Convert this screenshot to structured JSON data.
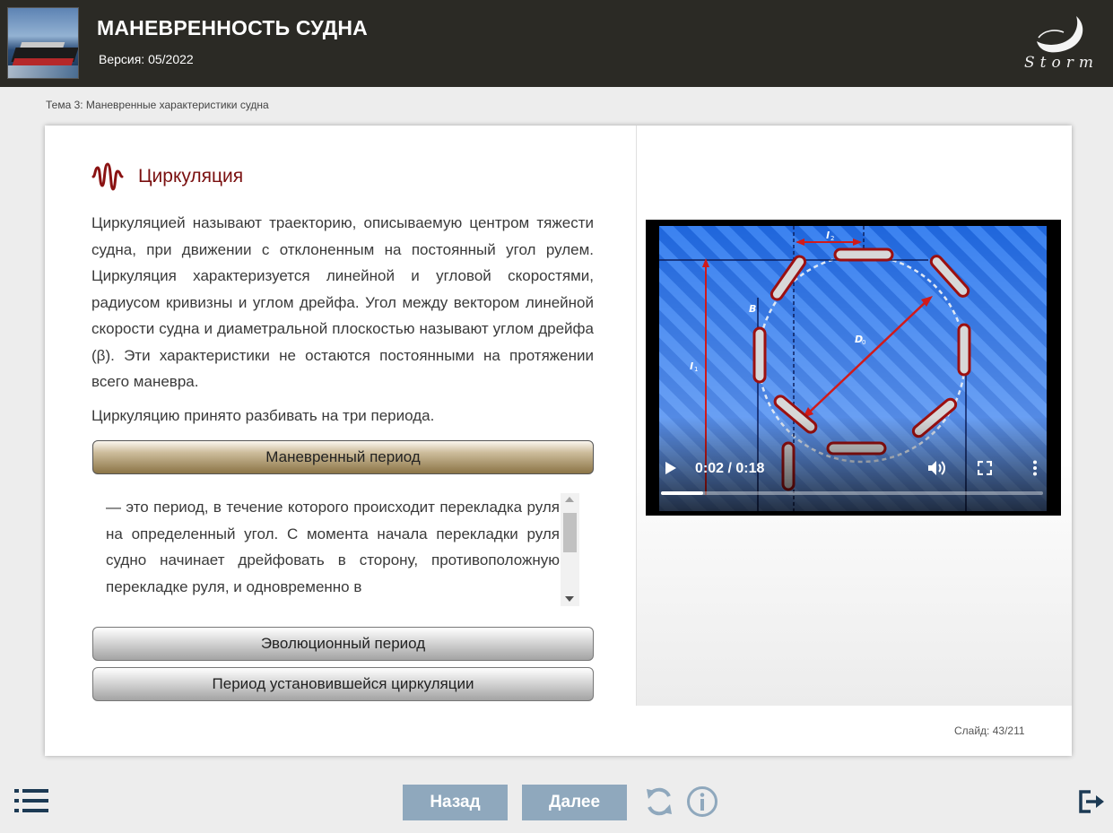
{
  "header": {
    "title": "МАНЕВРЕННОСТЬ СУДНА",
    "version": "Версия: 05/2022",
    "logo_text": "Storm"
  },
  "breadcrumb": "Тема 3: Маневренные характеристики судна",
  "section": {
    "title": "Циркуляция",
    "paragraph": "Циркуляцией называют траекторию, описываемую центром тяжести судна, при движении с отклоненным на постоянный угол рулем. Циркуляция характеризуется линейной и угловой скоростями, радиусом кривизны и углом дрейфа. Угол между вектором линейной скорости судна и диаметральной плоскостью называют углом дрейфа (β). Эти характеристики не остаются постоянными на протяжении всего маневра.",
    "intro": "Циркуляцию принято разбивать на три периода."
  },
  "accordion": [
    {
      "label": "Маневренный период",
      "expanded": true,
      "content": "— это период, в течение которого происходит перекладка руля на определенный угол. С момента начала перекладки руля судно начинает дрейфовать в сторону, противоположную перекладке руля, и одновременно в"
    },
    {
      "label": "Эволюционный период",
      "expanded": false
    },
    {
      "label": "Период установившейся циркуляции",
      "expanded": false
    }
  ],
  "video": {
    "time": "0:02 / 0:18",
    "progress_fraction": 0.11,
    "labels": {
      "l2": "l2",
      "l1": "l1",
      "b": "B",
      "d0": "D0"
    }
  },
  "slide": {
    "label": "Слайд:",
    "counter": "43/211"
  },
  "nav": {
    "back": "Назад",
    "next": "Далее"
  },
  "icons": {
    "heading": "wave-icon",
    "menu": "list-menu-icon",
    "reload": "reload-icon",
    "info": "info-icon",
    "exit": "exit-icon"
  },
  "colors": {
    "header_bg": "#2b2a25",
    "accent_red": "#7a1010",
    "nav_button": "#8fa8bd",
    "accordion_active": "#8b7446"
  }
}
